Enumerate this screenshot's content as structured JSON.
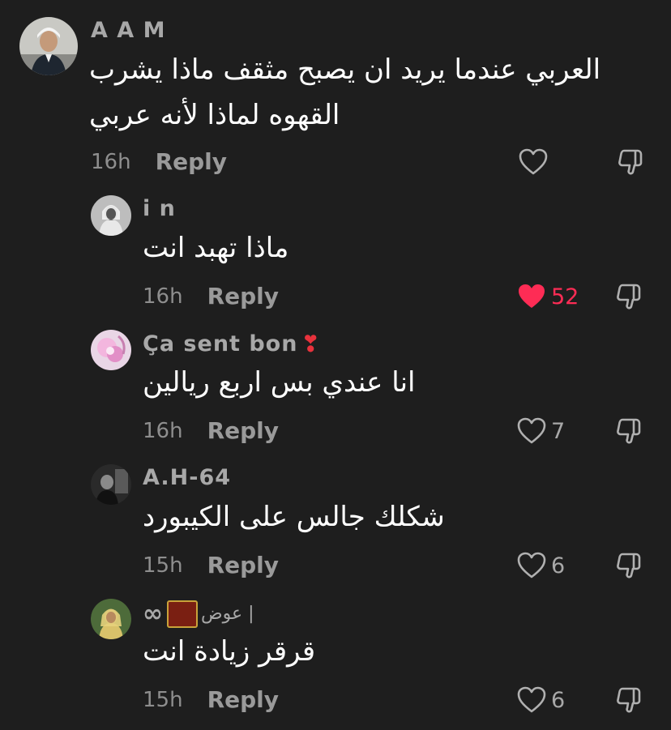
{
  "comments": [
    {
      "username": "A A M",
      "text_lines": [
        "العربي عندما يريد ان يصبح مثقف ماذا يشرب",
        "القهوه لماذا لأنه عربي"
      ],
      "time": "16h",
      "reply_label": "Reply",
      "likes": "",
      "liked": false,
      "avatar_icon": "avatar-man-suit"
    },
    {
      "username": "i n",
      "text": "ماذا تهبد انت",
      "time": "16h",
      "reply_label": "Reply",
      "likes": "52",
      "liked": true,
      "avatar_icon": "avatar-man-bw"
    },
    {
      "username": "Ça sent bon",
      "username_emoji": "❣",
      "text": "انا عندي بس اربع ريالين",
      "time": "16h",
      "reply_label": "Reply",
      "likes": "7",
      "liked": false,
      "avatar_icon": "avatar-pink-flower"
    },
    {
      "username": "A.H-64",
      "text": "شكلك جالس على الكيبورد",
      "time": "15h",
      "reply_label": "Reply",
      "likes": "6",
      "liked": false,
      "avatar_icon": "avatar-dark-photo"
    },
    {
      "username": "عوض |",
      "username_prefix": "∞",
      "username_emoji": "🧮",
      "text": "قرقر زيادة انت",
      "time": "15h",
      "reply_label": "Reply",
      "likes": "6",
      "liked": false,
      "avatar_icon": "avatar-man-green"
    }
  ],
  "colors": {
    "background": "#1e1e1e",
    "like_active": "#fe2c55",
    "muted_text": "#a8a8a8"
  }
}
